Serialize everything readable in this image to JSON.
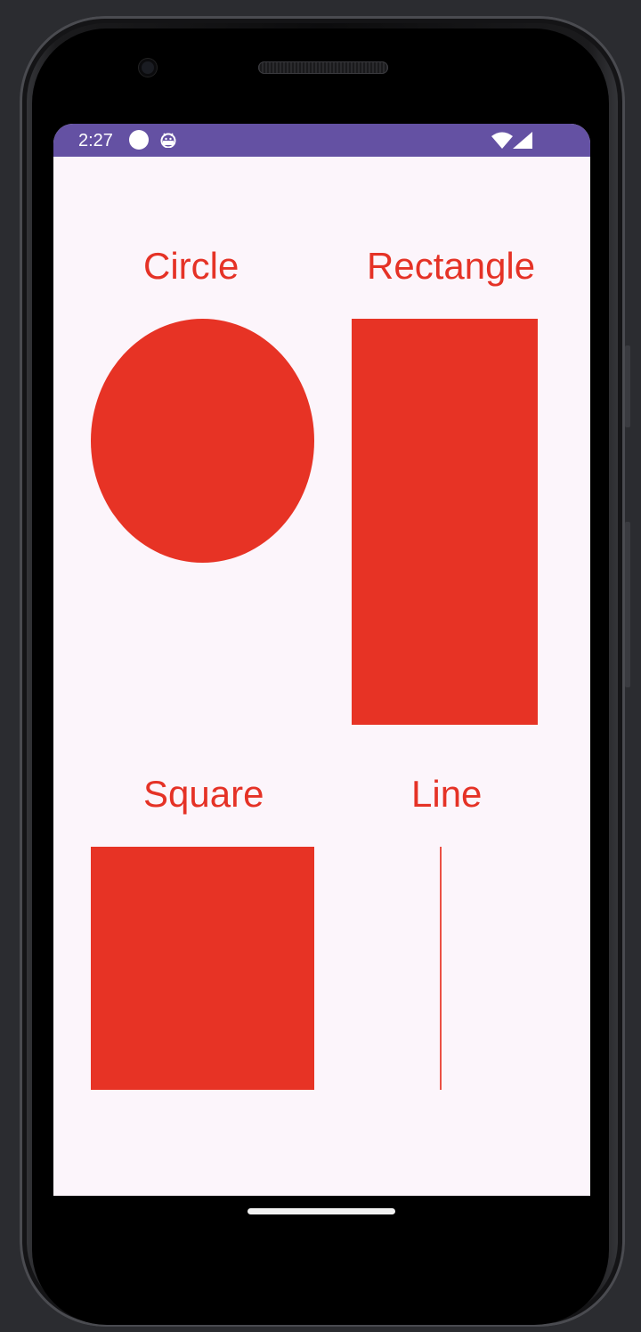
{
  "status_bar": {
    "time": "2:27",
    "icons": [
      "circle-notification-icon",
      "android-icon",
      "wifi-icon",
      "signal-icon"
    ],
    "background": "#6451a3"
  },
  "shapes": {
    "circle_label": "Circle",
    "rectangle_label": "Rectangle",
    "square_label": "Square",
    "line_label": "Line",
    "color": "#e73325",
    "label_color": "#e53226"
  },
  "screen_background": "#fcf5fb"
}
